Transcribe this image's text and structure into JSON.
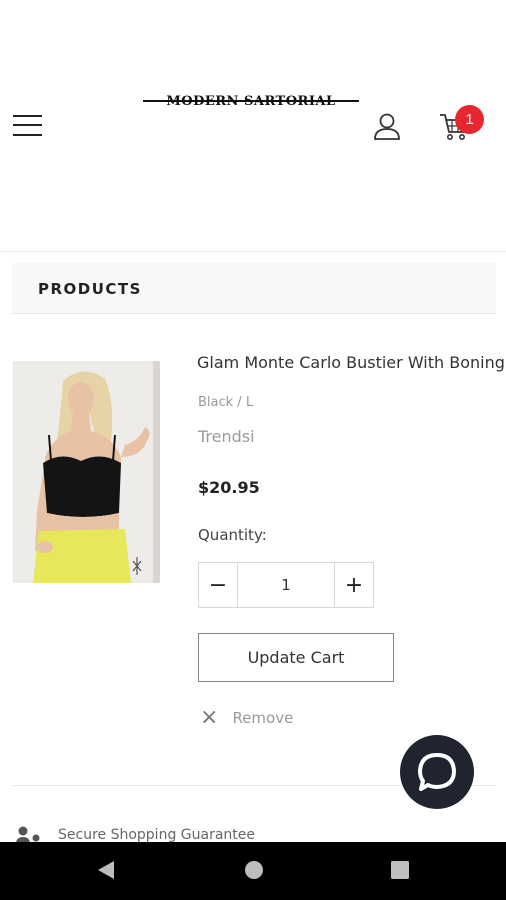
{
  "header": {
    "logo_text": "MODERN SARTORIAL",
    "cart_count": "1"
  },
  "products_section": {
    "heading": "PRODUCTS"
  },
  "cart_item": {
    "title": "Glam Monte Carlo Bustier With Boning",
    "variant": "Black / L",
    "vendor": "Trendsi",
    "price": "$20.95",
    "quantity_label": "Quantity:",
    "quantity_value": "1",
    "minus_symbol": "−",
    "plus_symbol": "+",
    "update_label": "Update Cart",
    "remove_label": "Remove",
    "remove_symbol": "×"
  },
  "footer": {
    "secure_text": "Secure Shopping Guarantee"
  },
  "colors": {
    "badge": "#e8262f",
    "chat_button": "#1f2430",
    "nav_bar": "#000000"
  },
  "icons": {
    "menu": "hamburger-menu-icon",
    "user": "user-icon",
    "cart": "cart-icon",
    "chat": "chat-bubble-icon",
    "remove": "close-icon",
    "back": "back-triangle-icon",
    "home": "home-circle-icon",
    "recent": "recent-square-icon"
  }
}
